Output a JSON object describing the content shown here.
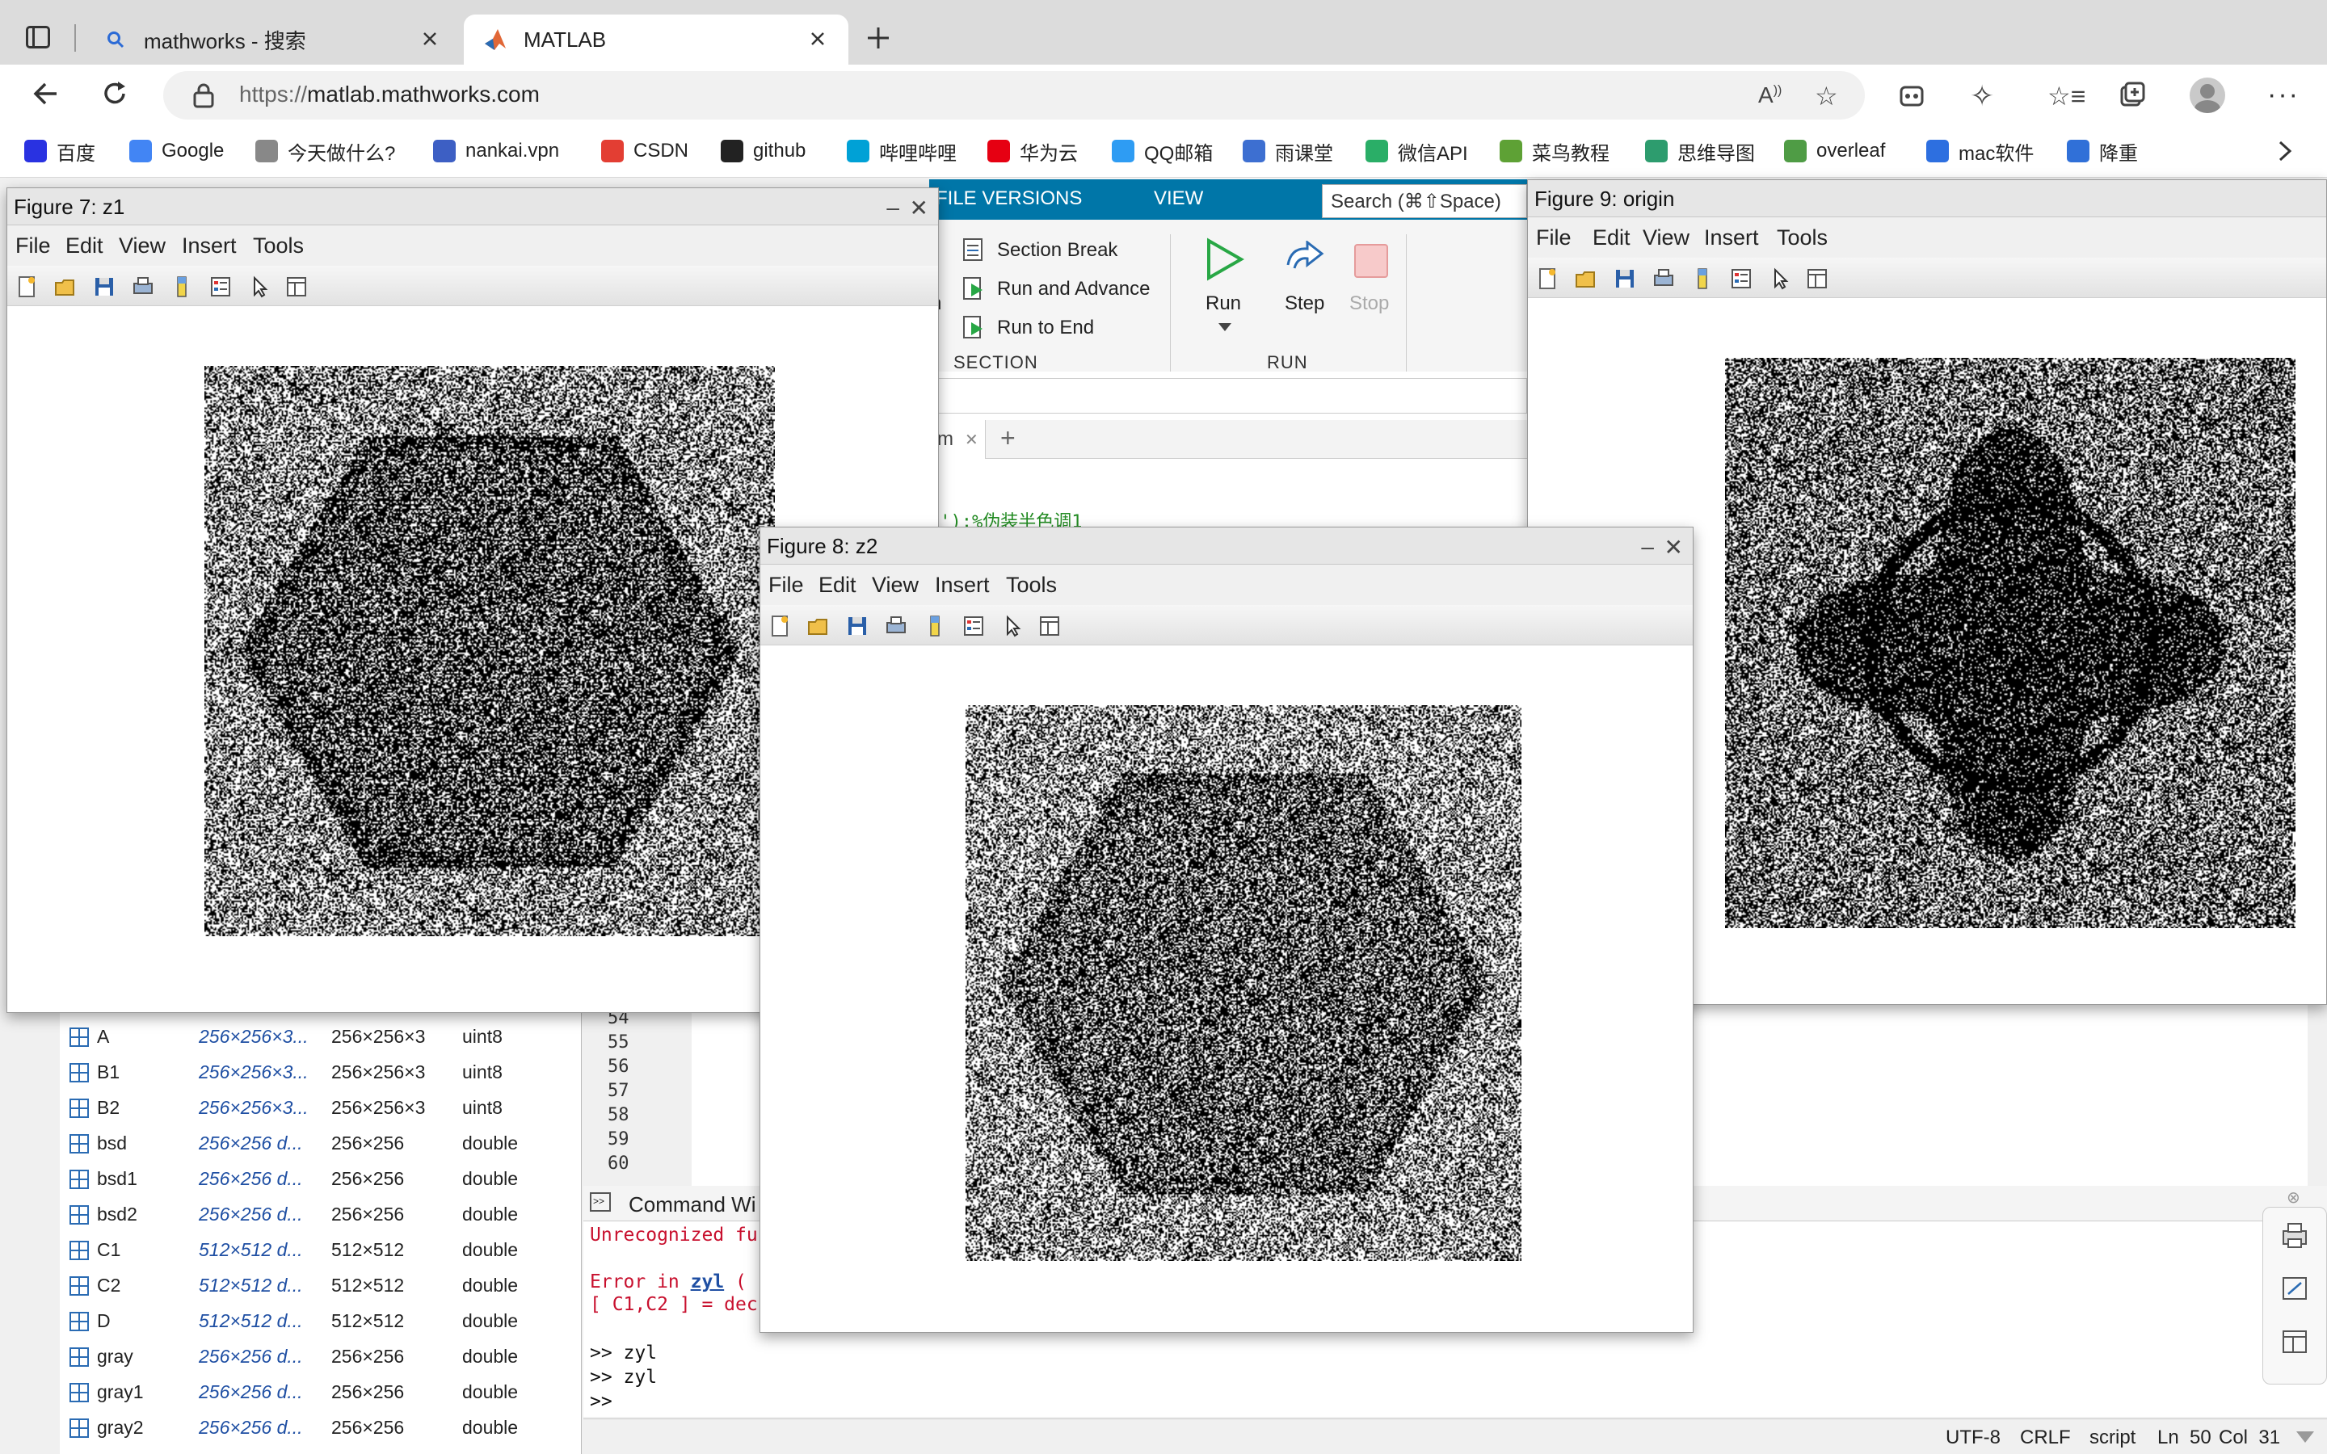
{
  "browser": {
    "tabs": [
      {
        "title": "mathworks - 搜索",
        "active": false
      },
      {
        "title": "MATLAB",
        "active": true
      }
    ],
    "url_prefix": "https://",
    "url_host": "matlab.mathworks.com",
    "bookmarks": [
      {
        "label": "百度",
        "icon": "baidu-icon",
        "color": "#2932e1"
      },
      {
        "label": "Google",
        "icon": "google-icon",
        "color": "#4285f4"
      },
      {
        "label": "今天做什么?",
        "icon": "moon-icon",
        "color": "#888888"
      },
      {
        "label": "nankai.vpn",
        "icon": "vpn-icon",
        "color": "#3d5fc4"
      },
      {
        "label": "CSDN",
        "icon": "csdn-icon",
        "color": "#e33e33"
      },
      {
        "label": "github",
        "icon": "github-icon",
        "color": "#222222"
      },
      {
        "label": "哔哩哔哩",
        "icon": "bilibili-icon",
        "color": "#00a1d6"
      },
      {
        "label": "华为云",
        "icon": "huawei-icon",
        "color": "#e60012"
      },
      {
        "label": "QQ邮箱",
        "icon": "qq-mail-icon",
        "color": "#2e9cf3"
      },
      {
        "label": "雨课堂",
        "icon": "rain-classroom-icon",
        "color": "#3d6fd1"
      },
      {
        "label": "微信API",
        "icon": "wechat-icon",
        "color": "#2aae67"
      },
      {
        "label": "菜鸟教程",
        "icon": "runoob-icon",
        "color": "#5ea135"
      },
      {
        "label": "思维导图",
        "icon": "mindmap-icon",
        "color": "#2d9c6e"
      },
      {
        "label": "overleaf",
        "icon": "overleaf-icon",
        "color": "#4f9c45"
      },
      {
        "label": "mac软件",
        "icon": "mac-software-icon",
        "color": "#2d6fe0"
      },
      {
        "label": "降重",
        "icon": "rewrite-icon",
        "color": "#3070d8"
      }
    ]
  },
  "ribbon": {
    "tabs": [
      "FILE VERSIONS",
      "VIEW"
    ],
    "search_placeholder": "Search (⌘⇧Space)",
    "section_items": [
      "Section Break",
      "Run and Advance",
      "Run to End"
    ],
    "section_label": "SECTION",
    "run_buttons": [
      "Run",
      "Step",
      "Stop"
    ],
    "run_label": "RUN",
    "fragment_n": "n"
  },
  "editor": {
    "tab_fragment": "m",
    "code_fragment": "p');%伪装半色调1",
    "line_numbers": [
      "54",
      "55",
      "56",
      "57",
      "58",
      "59",
      "60"
    ]
  },
  "workspace": {
    "rows": [
      {
        "name": "A",
        "size": "256×256×3...",
        "dims": "256×256×3",
        "class": "uint8"
      },
      {
        "name": "B1",
        "size": "256×256×3...",
        "dims": "256×256×3",
        "class": "uint8"
      },
      {
        "name": "B2",
        "size": "256×256×3...",
        "dims": "256×256×3",
        "class": "uint8"
      },
      {
        "name": "bsd",
        "size": "256×256 d...",
        "dims": "256×256",
        "class": "double"
      },
      {
        "name": "bsd1",
        "size": "256×256 d...",
        "dims": "256×256",
        "class": "double"
      },
      {
        "name": "bsd2",
        "size": "256×256 d...",
        "dims": "256×256",
        "class": "double"
      },
      {
        "name": "C1",
        "size": "512×512 d...",
        "dims": "512×512",
        "class": "double"
      },
      {
        "name": "C2",
        "size": "512×512 d...",
        "dims": "512×512",
        "class": "double"
      },
      {
        "name": "D",
        "size": "512×512 d...",
        "dims": "512×512",
        "class": "double"
      },
      {
        "name": "gray",
        "size": "256×256 d...",
        "dims": "256×256",
        "class": "double"
      },
      {
        "name": "gray1",
        "size": "256×256 d...",
        "dims": "256×256",
        "class": "double"
      },
      {
        "name": "gray2",
        "size": "256×256 d...",
        "dims": "256×256",
        "class": "double"
      }
    ]
  },
  "command": {
    "title": "Command Wi",
    "line1": "Unrecognized fu",
    "line2a": "Error in ",
    "line2b": "zyl",
    "line2c": " (",
    "line3": "[ C1,C2 ] = dec",
    "line4": ">> zyl",
    "line5": ">> zyl",
    "line6": ">>"
  },
  "status": {
    "encoding": "UTF-8",
    "eol": "CRLF",
    "mode": "script",
    "ln": "Ln  50",
    "col": "Col  31"
  },
  "figures": {
    "menu": [
      "File",
      "Edit",
      "View",
      "Insert",
      "Tools"
    ],
    "fig7": {
      "title": "Figure 7: z1"
    },
    "fig8": {
      "title": "Figure 8: z2"
    },
    "fig9": {
      "title": "Figure 9: origin"
    },
    "minimize": "–",
    "close": "✕"
  },
  "colors": {
    "ribbon_blue": "#0076a8",
    "error_red": "#c8102e",
    "link_blue": "#1f4fa3"
  }
}
